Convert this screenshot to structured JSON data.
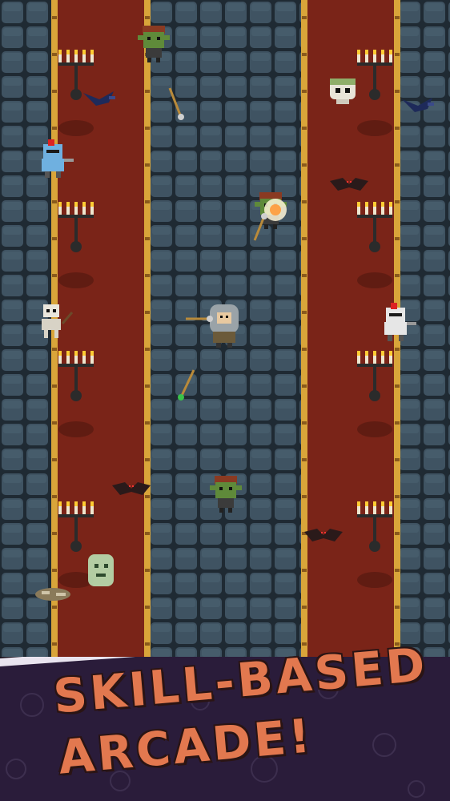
{
  "banner": {
    "line1": "SKILL-BASED",
    "line2": "ARCADE!"
  },
  "colors": {
    "floor_tile": "#3f5362",
    "floor_tile_light": "#4b6272",
    "floor_grout": "#1f2a33",
    "carpet": "#7a2418",
    "carpet_dark": "#5a1a12",
    "gold_border": "#d9a53a",
    "banner_bg": "#2a1c3a",
    "banner_text": "#e2784f",
    "candle_flame": "#ffcc33"
  },
  "sprites": [
    {
      "name": "goblin-enemy",
      "icon": "goblin"
    },
    {
      "name": "goblin-enemy",
      "icon": "goblin-hit"
    },
    {
      "name": "goblin-enemy",
      "icon": "goblin"
    },
    {
      "name": "skull-enemy",
      "icon": "skull"
    },
    {
      "name": "ghost-enemy",
      "icon": "ghost"
    },
    {
      "name": "skeleton-enemy",
      "icon": "skeleton"
    },
    {
      "name": "knight-enemy",
      "icon": "knight-blue"
    },
    {
      "name": "knight-enemy",
      "icon": "knight-white"
    },
    {
      "name": "crow-enemy",
      "icon": "crow"
    },
    {
      "name": "crow-enemy",
      "icon": "crow"
    },
    {
      "name": "bat-enemy",
      "icon": "bat"
    },
    {
      "name": "bat-enemy",
      "icon": "bat"
    },
    {
      "name": "bat-enemy",
      "icon": "bat"
    },
    {
      "name": "player-wizard",
      "icon": "hooded-archer"
    },
    {
      "name": "arrow-projectile",
      "icon": "arrow"
    },
    {
      "name": "arrow-projectile",
      "icon": "arrow"
    },
    {
      "name": "arrow-projectile",
      "icon": "arrow-green"
    },
    {
      "name": "arrow-projectile",
      "icon": "arrow"
    },
    {
      "name": "bone-pile",
      "icon": "bones"
    }
  ]
}
